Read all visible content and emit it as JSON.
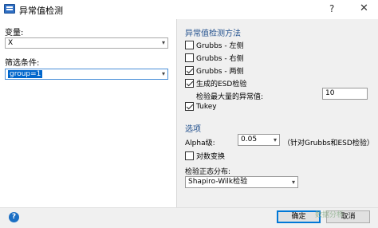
{
  "window": {
    "title": "异常值检测",
    "help": "?",
    "close": "✕"
  },
  "left": {
    "variable_label": "变量:",
    "variable_value": "X",
    "filter_label": "筛选条件:",
    "filter_value": "group=1"
  },
  "right": {
    "methods_title": "异常值检测方法",
    "methods": [
      {
        "label": "Grubbs - 左侧",
        "checked": false
      },
      {
        "label": "Grubbs - 右侧",
        "checked": false
      },
      {
        "label": "Grubbs - 两侧",
        "checked": true
      },
      {
        "label": "生成的ESD检验",
        "checked": true
      }
    ],
    "max_outliers_label": "检验最大量的异常值:",
    "max_outliers_value": "10",
    "tukey": {
      "label": "Tukey",
      "checked": true
    },
    "options_title": "选项",
    "alpha_label": "Alpha级:",
    "alpha_value": "0.05",
    "alpha_note": "（针对Grubbs和ESD检验）",
    "log_transform": {
      "label": "对数变换",
      "checked": false
    },
    "normality_label": "检验正态分布:",
    "normality_value": "Shapiro-Wilk检验"
  },
  "buttons": {
    "ok": "确定",
    "cancel": "取消"
  },
  "watermark": "数据分析"
}
